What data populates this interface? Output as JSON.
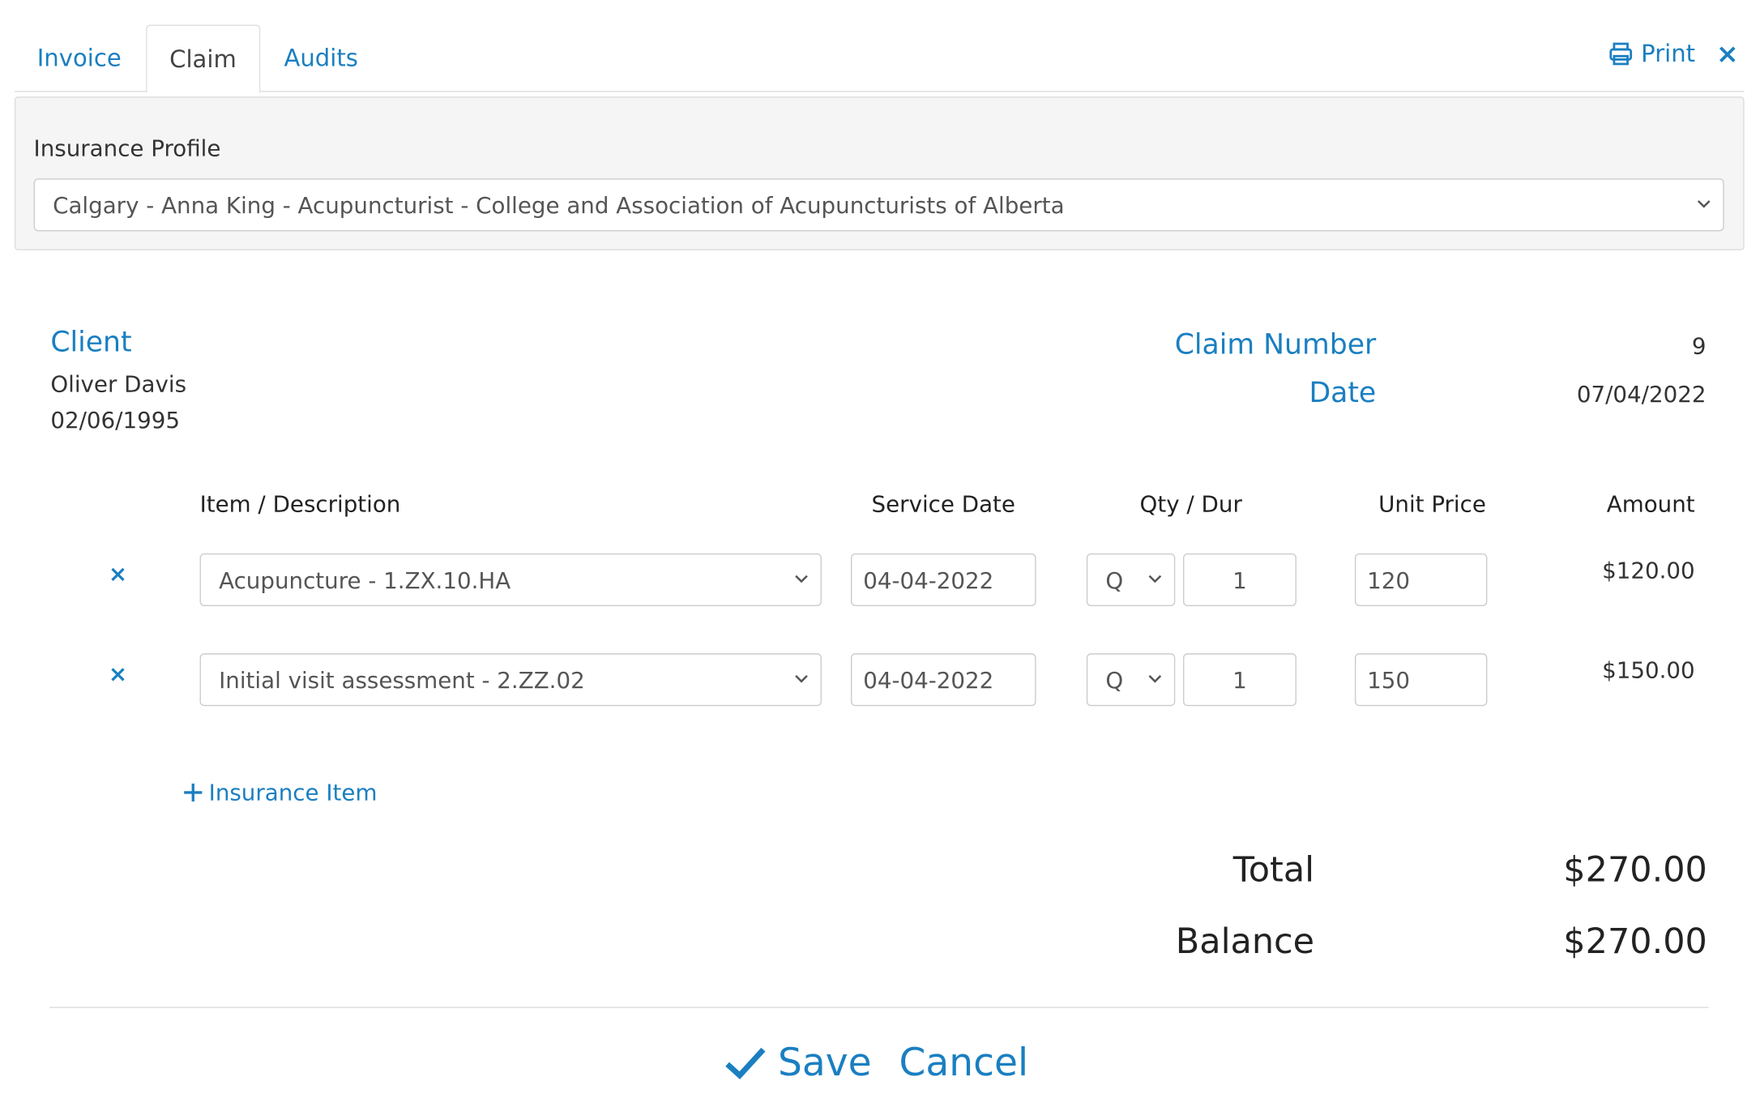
{
  "tabs": [
    {
      "label": "Invoice"
    },
    {
      "label": "Claim"
    },
    {
      "label": "Audits"
    }
  ],
  "toolbar": {
    "print_label": "Print",
    "close_label": "×"
  },
  "insurance_profile": {
    "label": "Insurance Profile",
    "selected": "Calgary - Anna King - Acupuncturist - College and Association of Acupuncturists of Alberta"
  },
  "client": {
    "heading": "Client",
    "name": "Oliver Davis",
    "dob": "02/06/1995"
  },
  "claim": {
    "number_label": "Claim Number",
    "number": "9",
    "date_label": "Date",
    "date": "07/04/2022"
  },
  "table": {
    "headers": {
      "item": "Item / Description",
      "service_date": "Service Date",
      "qty": "Qty / Dur",
      "unit_price": "Unit Price",
      "amount": "Amount"
    },
    "rows": [
      {
        "remove": "×",
        "item": "Acupuncture - 1.ZX.10.HA",
        "service_date": "04-04-2022",
        "qty_unit": "Q",
        "qty": "1",
        "unit_price": "120",
        "amount": "$120.00"
      },
      {
        "remove": "×",
        "item": "Initial visit assessment - 2.ZZ.02",
        "service_date": "04-04-2022",
        "qty_unit": "Q",
        "qty": "1",
        "unit_price": "150",
        "amount": "$150.00"
      }
    ]
  },
  "add_item_label": "Insurance Item",
  "totals": {
    "total_label": "Total",
    "total": "$270.00",
    "balance_label": "Balance",
    "balance": "$270.00"
  },
  "actions": {
    "save_label": "Save",
    "cancel_label": "Cancel"
  },
  "colors": {
    "accent": "#1a7fc1",
    "panel_bg": "#f5f5f5",
    "border": "#cccccc"
  }
}
